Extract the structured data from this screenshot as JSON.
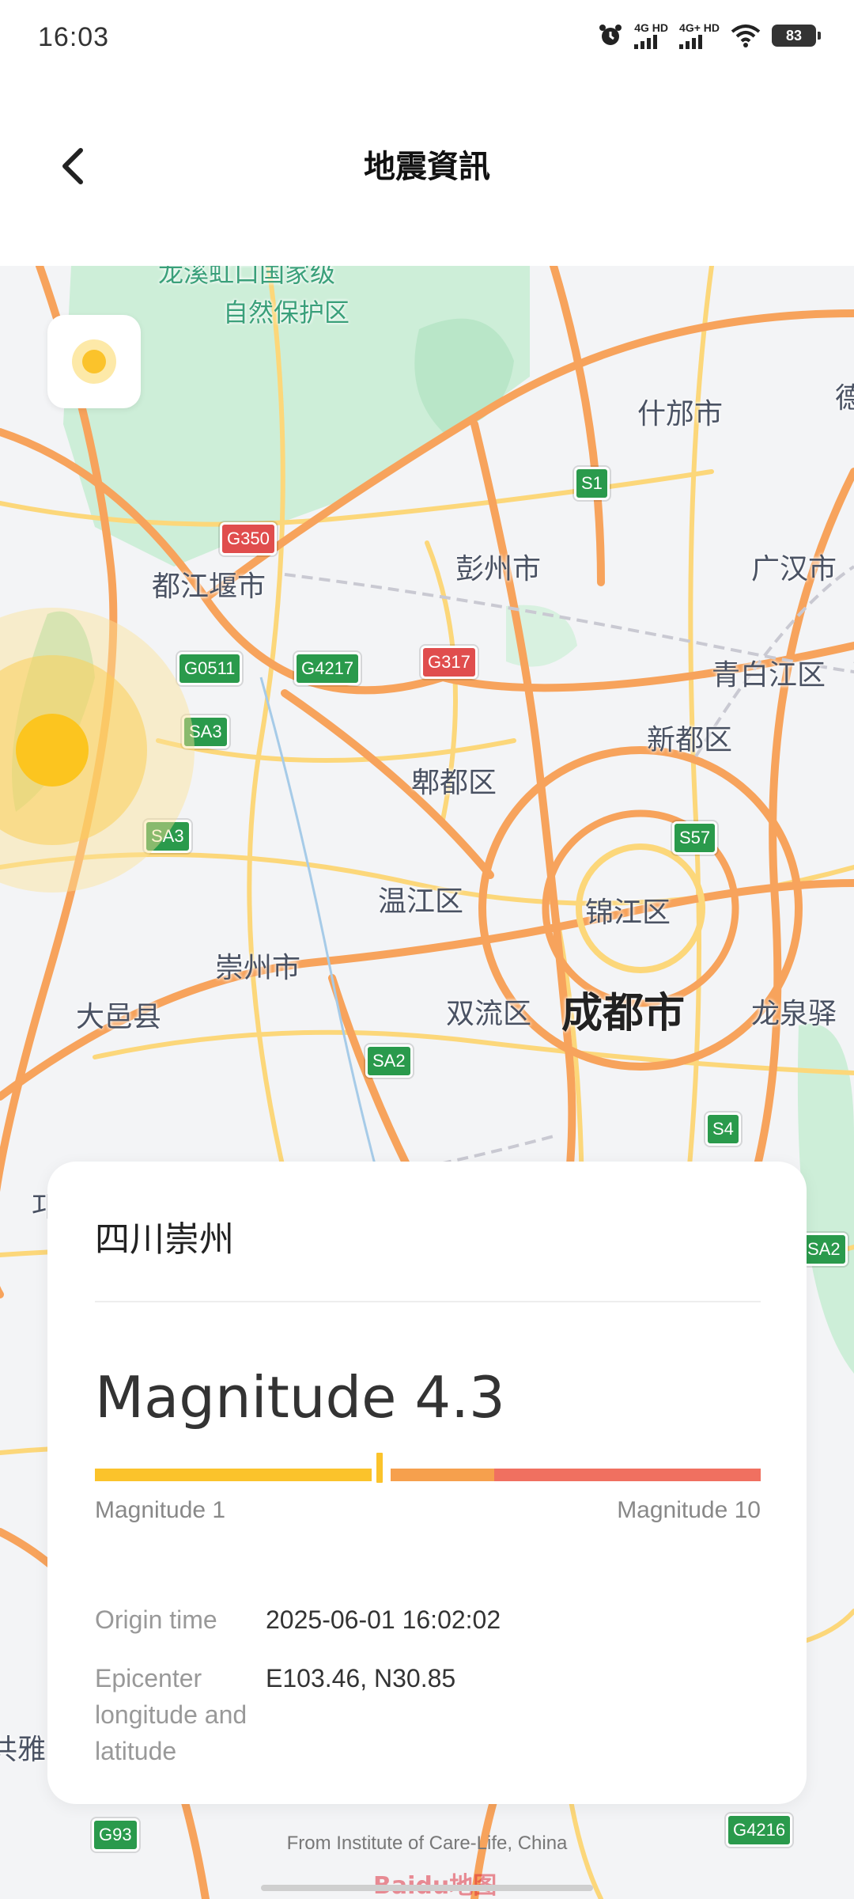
{
  "status_bar": {
    "time": "16:03",
    "sim1": "4G HD",
    "sim2": "4G+ HD",
    "battery": "83",
    "icons": [
      "alarm-icon",
      "signal-icon",
      "signal-icon",
      "wifi-icon",
      "battery-icon"
    ]
  },
  "header": {
    "title": "地震資訊",
    "back_icon": "chevron-left-icon"
  },
  "map": {
    "labels": {
      "park1": "龙溪虹口国家级",
      "park2": "自然保护区",
      "shifang": "什邡市",
      "de": "德",
      "pengzhou": "彭州市",
      "guanghan": "广汉市",
      "dujiangyan": "都江堰市",
      "qingbaijiang": "青白江区",
      "xindu": "新都区",
      "pidu": "郫都区",
      "wenjiang": "温江区",
      "jinjiang": "锦江区",
      "chongzhou": "崇州市",
      "dayi": "大邑县",
      "shuangliu": "双流区",
      "chengdu": "成都市",
      "longquanyi": "龙泉驿",
      "gongya": "共雅",
      "qiong": "邛"
    },
    "shields": {
      "s1": "S1",
      "g350": "G350",
      "g0511": "G0511",
      "g4217": "G4217",
      "g317": "G317",
      "sa3a": "SA3",
      "sa3b": "SA3",
      "s57": "S57",
      "sa2": "SA2",
      "s4": "S4",
      "sa2b": "SA2",
      "g93": "G93",
      "g4216": "G4216"
    },
    "colors": {
      "major_road": "#f7a35c",
      "minor_road": "#fcd77a",
      "park": "#cdeed8",
      "epicenter": "#fcc51f"
    }
  },
  "card": {
    "location": "四川崇州",
    "magnitude_label": "Magnitude",
    "magnitude_value": "4.3",
    "magnitude": 4.3,
    "scale_min": "Magnitude 1",
    "scale_max": "Magnitude 10",
    "origin_time_label": "Origin time",
    "origin_time_value": "2025-06-01 16:02:02",
    "epicenter_label": "Epicenter longitude and latitude",
    "epicenter_value": "E103.46, N30.85",
    "scale_colors": [
      "#fbc32b",
      "#f6a04d",
      "#f07060"
    ]
  },
  "footer": {
    "source": "From Institute of Care-Life, China",
    "map_logo": "Baidu地图"
  }
}
